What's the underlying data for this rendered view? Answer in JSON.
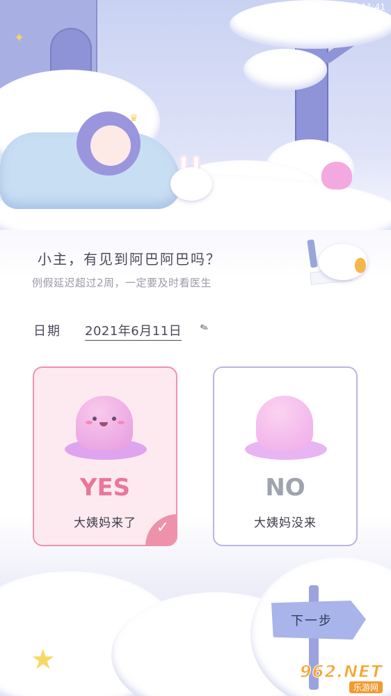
{
  "status_bar": {
    "left_icon": "A",
    "time": "11:41",
    "icons": [
      "wifi-icon",
      "signal-icon",
      "battery-icon"
    ]
  },
  "question": {
    "title": "小主，有见到阿巴阿巴吗？",
    "hint": "例假延迟超过2周，一定要及时看医生"
  },
  "date": {
    "label": "日期",
    "value": "2021年6月11日",
    "edit_icon": "pencil-icon"
  },
  "options": [
    {
      "word": "YES",
      "label": "大姨妈来了",
      "selected": true
    },
    {
      "word": "NO",
      "label": "大姨妈没来",
      "selected": false
    }
  ],
  "next_button": {
    "label": "下一步"
  },
  "watermark": {
    "main": "962.NET",
    "sub": "乐游网"
  },
  "colors": {
    "accent_pink": "#ee92ac",
    "yes_text": "#e9779a",
    "no_text": "#9fa3ae",
    "no_border": "#b9b6e2",
    "sign": "#a8b4ea"
  }
}
